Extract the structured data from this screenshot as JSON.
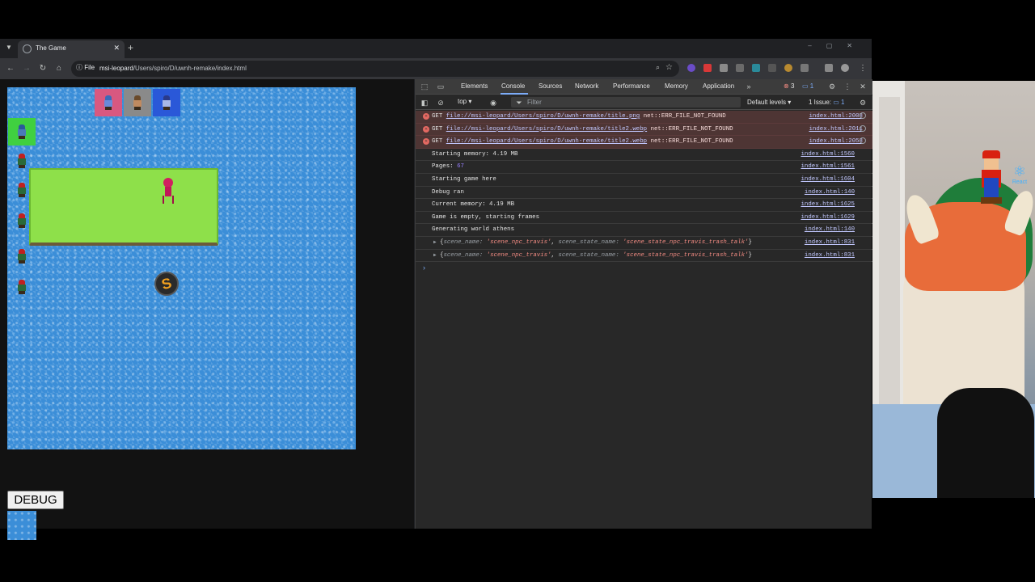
{
  "browser": {
    "tab_title": "The Game",
    "url_info_label": "File",
    "url_host": "msi-leopard",
    "url_path": "/Users/spiro/D/uwnh-remake/index.html"
  },
  "page": {
    "debug_button_label": "DEBUG"
  },
  "devtools": {
    "tabs": [
      "Elements",
      "Console",
      "Sources",
      "Network",
      "Performance",
      "Memory",
      "Application"
    ],
    "active_tab": "Console",
    "error_count": "3",
    "message_count": "1",
    "context": "top",
    "filter_placeholder": "Filter",
    "levels": "Default levels",
    "issues_label": "1 Issue:",
    "issues_count": "1",
    "errors": [
      {
        "method": "GET",
        "url": "file://msi-leopard/Users/spiro/D/uwnh-remake/title.png",
        "status": "net::ERR_FILE_NOT_FOUND",
        "source": "index.html:2008"
      },
      {
        "method": "GET",
        "url": "file://msi-leopard/Users/spiro/D/uwnh-remake/title2.webp",
        "status": "net::ERR_FILE_NOT_FOUND",
        "source": "index.html:2011"
      },
      {
        "method": "GET",
        "url": "file://msi-leopard/Users/spiro/D/uwnh-remake/title2.webp",
        "status": "net::ERR_FILE_NOT_FOUND",
        "source": "index.html:2053"
      }
    ],
    "logs": [
      {
        "text": "Starting memory: 4.19 MB",
        "source": "index.html:1560"
      },
      {
        "label": "Pages:",
        "value": "67",
        "source": "index.html:1561"
      },
      {
        "text": "Starting game here",
        "source": "index.html:1604"
      },
      {
        "text": "Debug ran",
        "source": "index.html:140"
      },
      {
        "text": "Current memory: 4.19 MB",
        "source": "index.html:1625"
      },
      {
        "text": "Game is empty, starting frames",
        "source": "index.html:1629"
      },
      {
        "text": "Generating world athens",
        "source": "index.html:140"
      }
    ],
    "objects": [
      {
        "k1": "scene_name:",
        "v1": "'scene_npc_travis'",
        "k2": "scene_state_name:",
        "v2": "'scene_state_npc_travis_trash_talk'",
        "source": "index.html:831"
      },
      {
        "k1": "scene_name:",
        "v1": "'scene_npc_travis'",
        "k2": "scene_state_name:",
        "v2": "'scene_state_npc_travis_trash_talk'",
        "source": "index.html:831"
      }
    ]
  },
  "webcam": {
    "overlay_label": "React"
  },
  "colors": {
    "water": "#3b8ed8",
    "grass": "#8ee04a",
    "devtools_bg": "#282828",
    "error_row": "#4e3534",
    "link": "#c2c8ff"
  }
}
